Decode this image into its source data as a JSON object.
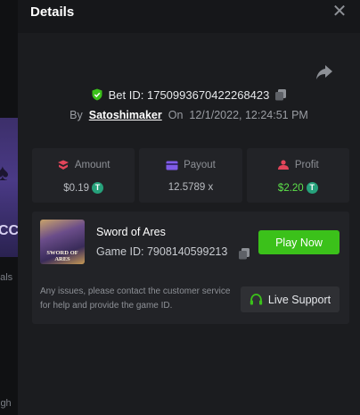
{
  "modal": {
    "title": "Details",
    "close_icon": "close-icon",
    "share_icon": "share-icon"
  },
  "bet": {
    "label": "Bet ID: 1750993670422268423",
    "by_label": "By",
    "username": "Satoshimaker",
    "on_label": "On",
    "date": "12/1/2022, 12:24:51 PM"
  },
  "stats": {
    "amount": {
      "label": "Amount",
      "value": "$0.19",
      "currency_icon": "tether-icon"
    },
    "payout": {
      "label": "Payout",
      "value": "12.5789 x"
    },
    "profit": {
      "label": "Profit",
      "value": "$2.20",
      "currency_icon": "tether-icon"
    }
  },
  "game": {
    "name": "Sword of Ares",
    "thumb_title": "SWORD OF ARES",
    "id_label": "Game ID: 7908140599213",
    "play_label": "Play Now",
    "notice": "Any issues, please contact the customer service for help and provide the game ID.",
    "support_label": "Live Support"
  },
  "backdrop": {
    "card_text": "CCA",
    "frag1": "nals",
    "frag2": "igh"
  },
  "colors": {
    "background": "#1b1c1f",
    "panel": "#222327",
    "accent_green": "#3bc11a",
    "profit_green": "#5de24a",
    "tether": "#26a17b"
  }
}
